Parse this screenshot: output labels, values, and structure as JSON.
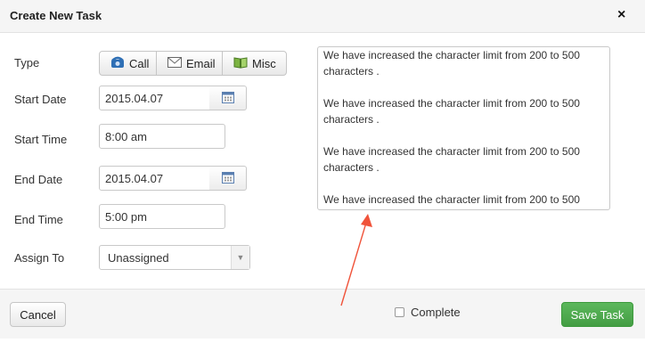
{
  "dialog": {
    "title": "Create New Task",
    "close_glyph": "×"
  },
  "form": {
    "type_label": "Type",
    "type_options": [
      "Call",
      "Email",
      "Misc"
    ],
    "start_date_label": "Start Date",
    "start_date_value": "2015.04.07",
    "start_time_label": "Start Time",
    "start_time_value": "8:00 am",
    "end_date_label": "End Date",
    "end_date_value": "2015.04.07",
    "end_time_label": "End Time",
    "end_time_value": "5:00 pm",
    "assign_label": "Assign To",
    "assign_value": "Unassigned"
  },
  "notes": {
    "paragraphs": [
      "We have increased the character limit from 200 to 500 characters .",
      "We have increased the character limit from 200 to 500 characters .",
      "We have increased the character limit from 200 to 500 characters .",
      "We have increased the character limit from 200 to 500"
    ]
  },
  "footer": {
    "cancel_label": "Cancel",
    "complete_label": "Complete",
    "save_label": "Save Task"
  },
  "colors": {
    "save": "#5cb85c",
    "annotation_arrow": "#f0533a",
    "header_bg": "#f5f5f5"
  },
  "icons": [
    "phone-icon",
    "email-icon",
    "book-icon",
    "calendar-icon",
    "close-icon",
    "chevron-down-icon"
  ]
}
